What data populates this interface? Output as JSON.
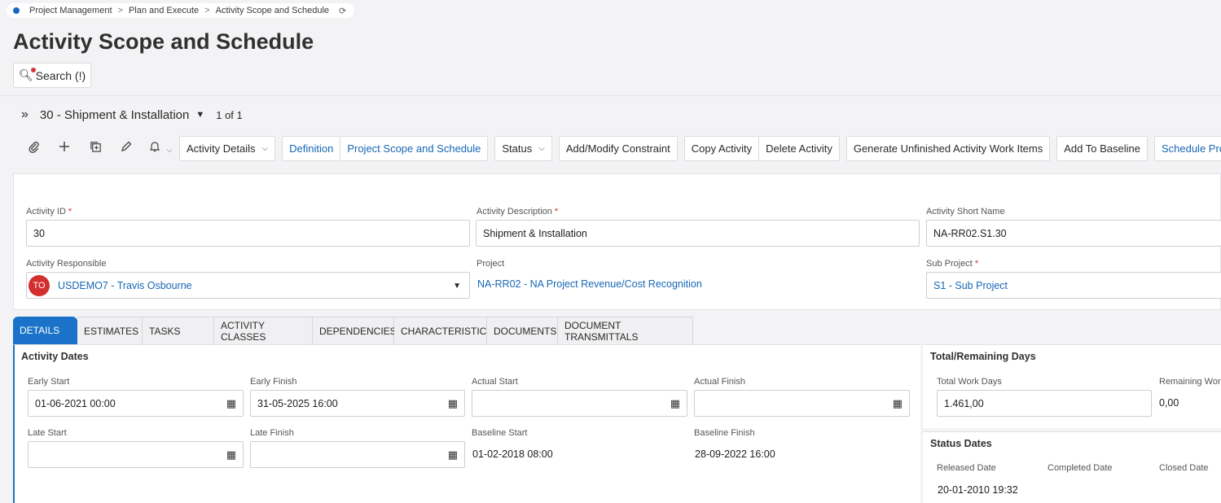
{
  "breadcrumb": {
    "items": [
      "Project Management",
      "Plan and Execute",
      "Activity Scope and Schedule"
    ],
    "separator": ">",
    "refresh_icon": "refresh-icon"
  },
  "page": {
    "title": "Activity Scope and Schedule"
  },
  "search": {
    "label": "Search (!)"
  },
  "record": {
    "expand_icon": "»",
    "title": "30 - Shipment & Installation",
    "caret": "▼",
    "count": "1 of 1"
  },
  "toolbar": {
    "icons": [
      "paperclip-icon",
      "plus-icon",
      "duplicate-icon",
      "pencil-icon",
      "bell-icon"
    ],
    "buttons": {
      "activity_details": "Activity Details",
      "definition": "Definition",
      "project_scope": "Project Scope and Schedule",
      "status": "Status",
      "add_constraint": "Add/Modify Constraint",
      "copy_activity": "Copy Activity",
      "delete_activity": "Delete Activity",
      "generate": "Generate Unfinished Activity Work Items",
      "baseline": "Add To Baseline",
      "schedule": "Schedule Project"
    }
  },
  "header": {
    "activity_id": {
      "label": "Activity ID",
      "value": "30",
      "required": "*"
    },
    "activity_description": {
      "label": "Activity Description",
      "value": "Shipment & Installation",
      "required": "*"
    },
    "activity_short_name": {
      "label": "Activity Short Name",
      "value": "NA-RR02.S1.30"
    },
    "activity_responsible": {
      "label": "Activity Responsible",
      "initials": "TO",
      "value": "USDEMO7 - Travis Osbourne"
    },
    "project": {
      "label": "Project",
      "value": "NA-RR02 - NA Project Revenue/Cost Recognition"
    },
    "sub_project": {
      "label": "Sub Project",
      "value": "S1 - Sub Project",
      "required": "*"
    }
  },
  "tabs": [
    "DETAILS",
    "ESTIMATES",
    "TASKS",
    "ACTIVITY CLASSES",
    "DEPENDENCIES",
    "CHARACTERISTICS",
    "DOCUMENTS",
    "DOCUMENT TRANSMITTALS"
  ],
  "activity_dates": {
    "title": "Activity Dates",
    "early_start": {
      "label": "Early Start",
      "value": "01-06-2021 00:00"
    },
    "early_finish": {
      "label": "Early Finish",
      "value": "31-05-2025 16:00"
    },
    "actual_start": {
      "label": "Actual Start",
      "value": ""
    },
    "actual_finish": {
      "label": "Actual Finish",
      "value": ""
    },
    "late_start": {
      "label": "Late Start",
      "value": ""
    },
    "late_finish": {
      "label": "Late Finish",
      "value": ""
    },
    "baseline_start": {
      "label": "Baseline Start",
      "value": "01-02-2018 08:00"
    },
    "baseline_finish": {
      "label": "Baseline Finish",
      "value": "28-09-2022 16:00"
    }
  },
  "remaining": {
    "title": "Total/Remaining Days",
    "total_work_days": {
      "label": "Total Work Days",
      "value": "1.461,00"
    },
    "remaining_work": {
      "label": "Remaining Wor",
      "value": "0,00"
    }
  },
  "status_dates": {
    "title": "Status Dates",
    "released": {
      "label": "Released Date",
      "value": "20-01-2010 19:32"
    },
    "completed": {
      "label": "Completed Date"
    },
    "closed": {
      "label": "Closed Date"
    }
  }
}
